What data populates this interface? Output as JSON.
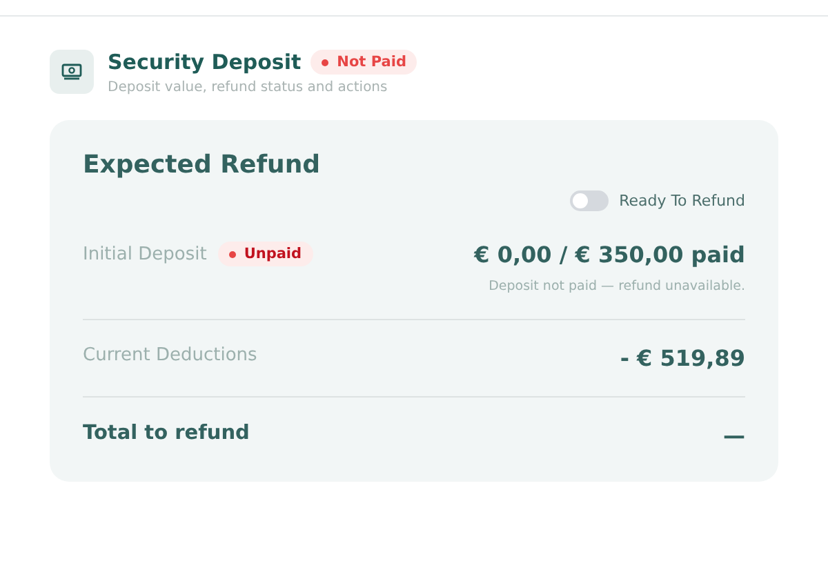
{
  "header": {
    "title": "Security Deposit",
    "status_badge": {
      "label": "Not Paid"
    },
    "subtitle": "Deposit value, refund status and actions"
  },
  "card": {
    "title": "Expected Refund",
    "toggle": {
      "label": "Ready To Refund",
      "on": false
    },
    "rows": [
      {
        "kind": "deposit",
        "label": "Initial Deposit",
        "badge": "Unpaid",
        "value": "€ 0,00 / € 350,00 paid",
        "note": "Deposit not paid — refund unavailable."
      },
      {
        "kind": "plain",
        "label": "Current Deductions",
        "value": "- € 519,89"
      },
      {
        "kind": "total",
        "label": "Total to refund",
        "value": "—"
      }
    ]
  }
}
